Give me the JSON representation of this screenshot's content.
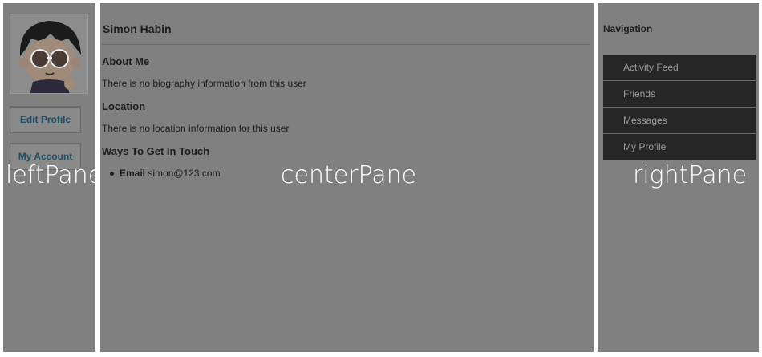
{
  "leftPane": {
    "avatar_alt": "",
    "edit_profile": "Edit Profile",
    "my_account": "My Account",
    "pane_label": "leftPane"
  },
  "centerPane": {
    "user_name": "Simon Habin",
    "sections": {
      "about_title": "About Me",
      "about_text": "There is no biography information from this user",
      "location_title": "Location",
      "location_text": "There is no location information for this user",
      "contact_title": "Ways To Get In Touch"
    },
    "contact": {
      "email_label": "Email",
      "email_value": "simon@123.com"
    },
    "pane_label": "centerPane"
  },
  "rightPane": {
    "nav_title": "Navigation",
    "nav_items": [
      "Activity Feed",
      "Friends",
      "Messages",
      "My Profile"
    ],
    "pane_label": "rightPane"
  },
  "colors": {
    "pane_bg": "#808080",
    "nav_bg": "#262626",
    "button_text": "#1f4f66"
  }
}
